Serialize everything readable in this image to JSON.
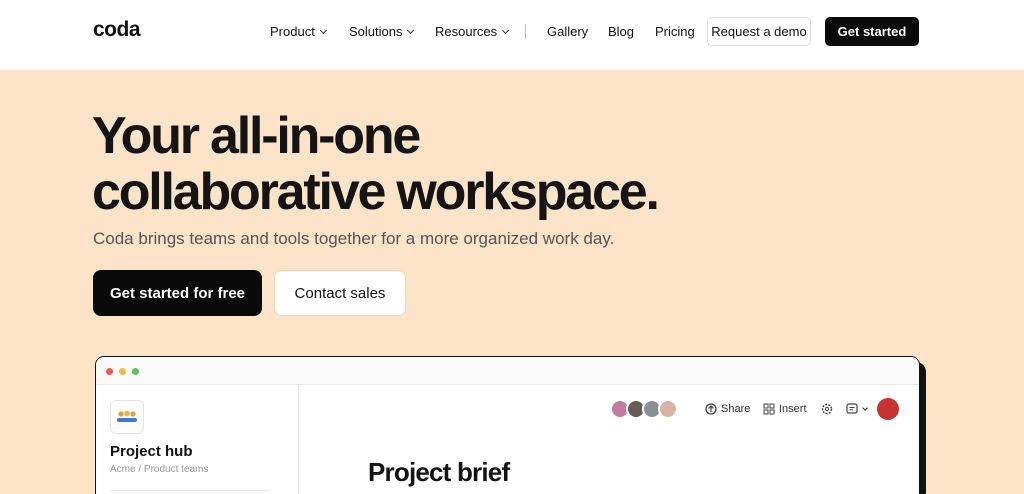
{
  "nav": {
    "logo": "coda",
    "items": [
      {
        "label": "Product",
        "dropdown": true
      },
      {
        "label": "Solutions",
        "dropdown": true
      },
      {
        "label": "Resources",
        "dropdown": true
      },
      {
        "label": "Gallery",
        "dropdown": false
      },
      {
        "label": "Blog",
        "dropdown": false
      },
      {
        "label": "Pricing",
        "dropdown": false
      }
    ],
    "demo_label": "Request a demo",
    "start_label": "Get started"
  },
  "hero": {
    "title_line1": "Your all-in-one",
    "title_line2": "collaborative workspace.",
    "subtitle": "Coda brings teams and tools together for a more organized work day.",
    "cta_primary": "Get started for free",
    "cta_secondary": "Contact sales"
  },
  "app_preview": {
    "window_dots": [
      "#ed5a50",
      "#f4bc3a",
      "#5fc15a"
    ],
    "sidebar": {
      "title": "Project hub",
      "path": "Acme / Product teams"
    },
    "toolbar": {
      "share": "Share",
      "insert": "Insert"
    },
    "avatar_colors": [
      "#c27a9e",
      "#6a5a55",
      "#8a8f95",
      "#d8b4a4"
    ],
    "user_avatar_color": "#c8322e",
    "doc_title": "Project brief"
  },
  "colors": {
    "hero_bg": "#fde3c8",
    "dark": "#0a0a0a"
  }
}
